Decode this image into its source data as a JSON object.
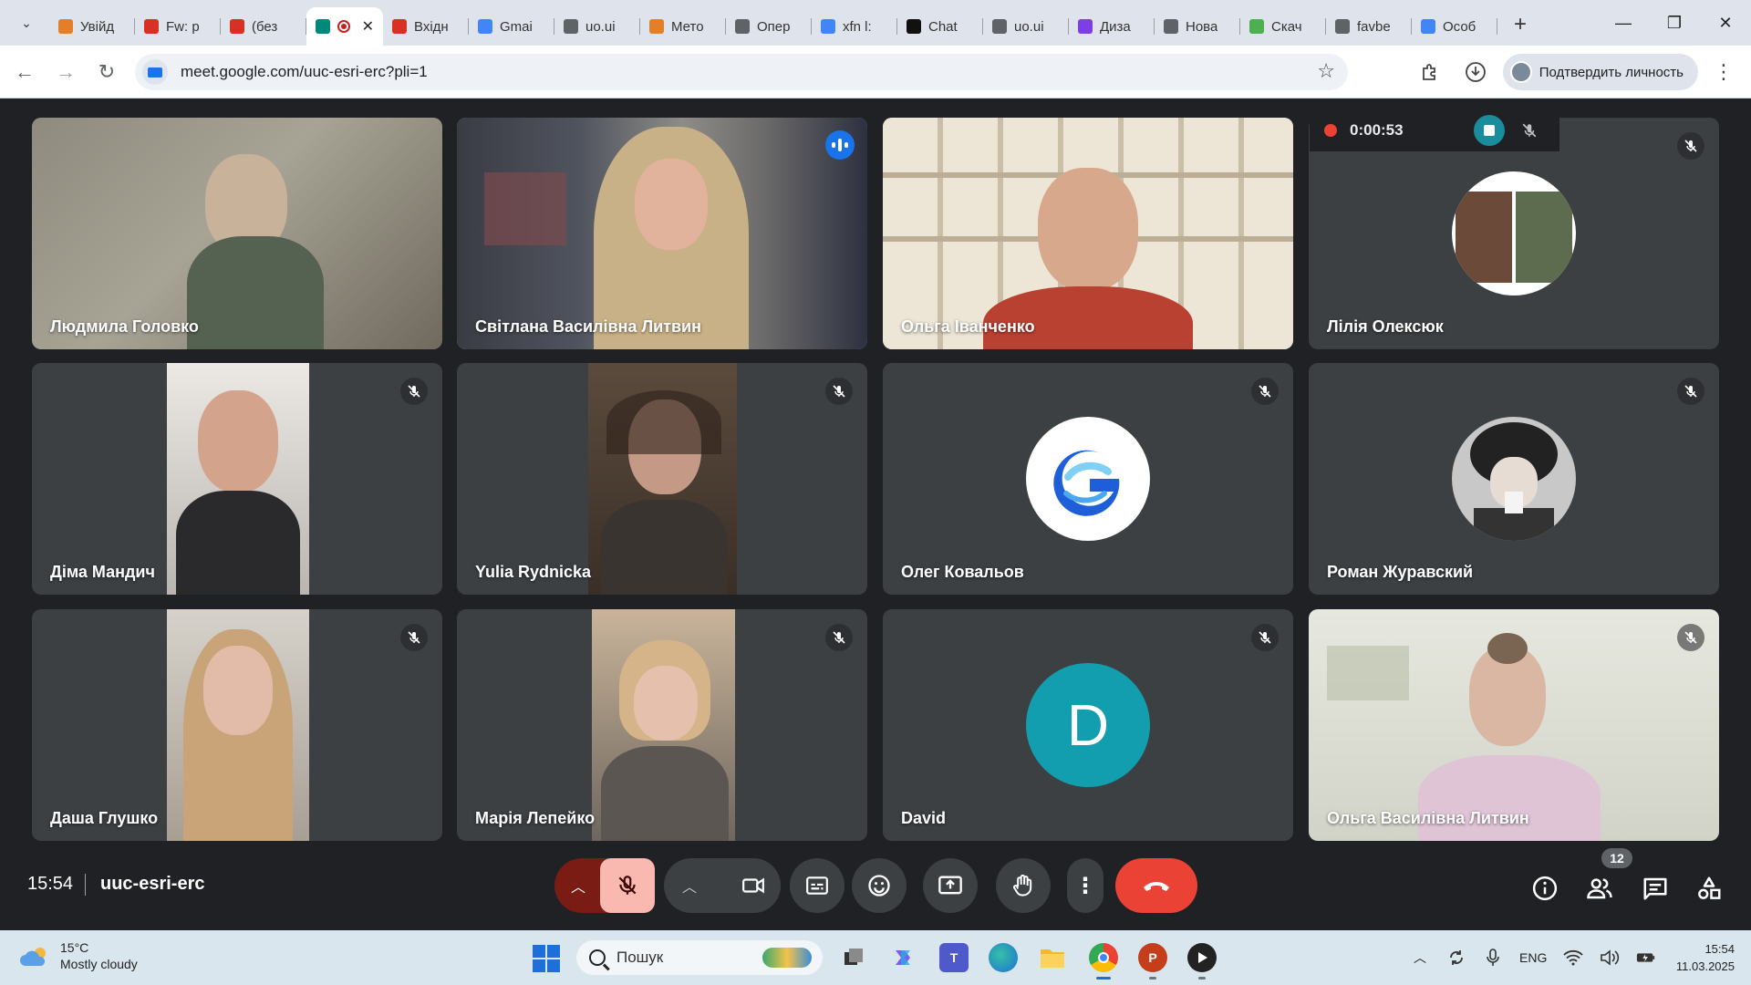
{
  "browser": {
    "tabs": [
      {
        "label": "Увійд",
        "icon": "moodle-icon",
        "color": "#e37f2b"
      },
      {
        "label": "Fw: p",
        "icon": "gmail-icon",
        "color": "#d93025"
      },
      {
        "label": "(без",
        "icon": "gmail-icon",
        "color": "#d93025"
      },
      {
        "label": "",
        "icon": "google-meet-icon",
        "color": "#00897b",
        "active": true,
        "recording": true
      },
      {
        "label": "Вхідн",
        "icon": "gmail-icon",
        "color": "#d93025"
      },
      {
        "label": "Gmai",
        "icon": "google-icon",
        "color": "#4285f4"
      },
      {
        "label": "uo.ui",
        "icon": "globe-icon",
        "color": "#5f6368"
      },
      {
        "label": "Мето",
        "icon": "moodle-icon",
        "color": "#e37f2b"
      },
      {
        "label": "Опер",
        "icon": "globe-icon",
        "color": "#5f6368"
      },
      {
        "label": "xfn l:",
        "icon": "google-icon",
        "color": "#4285f4"
      },
      {
        "label": "Chat",
        "icon": "chatgpt-icon",
        "color": "#111111"
      },
      {
        "label": "uo.ui",
        "icon": "globe-icon",
        "color": "#5f6368"
      },
      {
        "label": "Диза",
        "icon": "canva-icon",
        "color": "#7b3fe4"
      },
      {
        "label": "Нова",
        "icon": "chrome-icon",
        "color": "#5f6368"
      },
      {
        "label": "Скач",
        "icon": "download-arrow-icon",
        "color": "#4caf50"
      },
      {
        "label": "favbe",
        "icon": "globe-icon",
        "color": "#5f6368"
      },
      {
        "label": "Особ",
        "icon": "google-icon",
        "color": "#4285f4"
      }
    ],
    "url": "meet.google.com/uuc-esri-erc?pli=1",
    "profile_label": "Подтвердить личность"
  },
  "recording": {
    "timer": "0:00:53"
  },
  "participants": [
    {
      "name": "Людмила Головко",
      "muted": false,
      "type": "video"
    },
    {
      "name": "Світлана Василівна Литвин",
      "muted": false,
      "speaking": true,
      "type": "video"
    },
    {
      "name": "Ольга Іванченко",
      "muted": false,
      "type": "video"
    },
    {
      "name": "Лілія Олексюк",
      "muted": true,
      "type": "avatar-photo"
    },
    {
      "name": "Діма Мандич",
      "muted": true,
      "type": "video"
    },
    {
      "name": "Yulia Rydnicka",
      "muted": true,
      "type": "video"
    },
    {
      "name": "Олег Ковальов",
      "muted": true,
      "type": "avatar-logo"
    },
    {
      "name": "Роман Журавский",
      "muted": true,
      "type": "avatar-anime"
    },
    {
      "name": "Даша Глушко",
      "muted": true,
      "type": "video"
    },
    {
      "name": "Марія Лепейко",
      "muted": true,
      "type": "video"
    },
    {
      "name": "David",
      "muted": true,
      "type": "avatar-letter",
      "letter": "D"
    },
    {
      "name": "Ольга Василівна Литвин",
      "muted": true,
      "type": "video"
    }
  ],
  "controls": {
    "time": "15:54",
    "meeting_code": "uuc-esri-erc",
    "participant_count": "12"
  },
  "taskbar": {
    "weather_temp": "15°C",
    "weather_desc": "Mostly cloudy",
    "search_placeholder": "Пошук",
    "language": "ENG",
    "time": "15:54",
    "date": "11.03.2025"
  },
  "colors": {
    "meet_bg": "#202124",
    "tile_bg": "#3c4043",
    "speaking_border": "#8ab4f8",
    "end_call": "#ea4335",
    "mic_off_bg": "#f9b8b0",
    "avatar_letter_bg": "#129eaf"
  }
}
